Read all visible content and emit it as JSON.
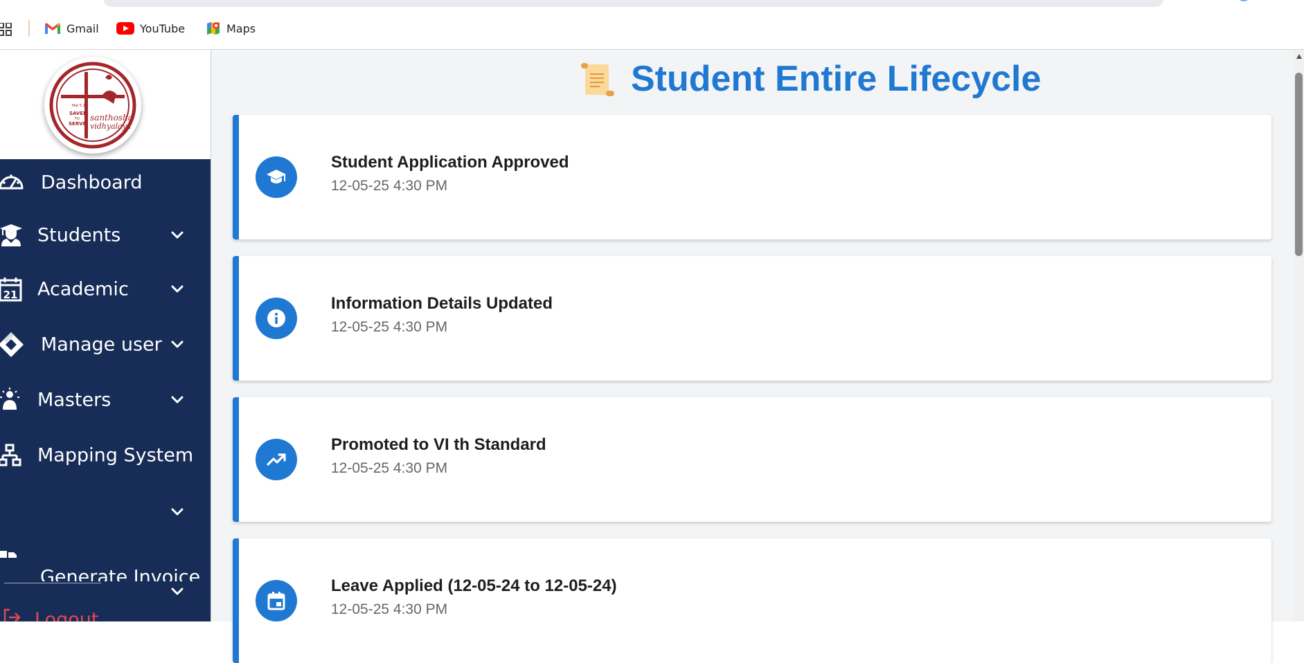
{
  "bookmarks": [
    {
      "label": "Gmail",
      "icon": "gmail-icon"
    },
    {
      "label": "YouTube",
      "icon": "youtube-icon"
    },
    {
      "label": "Maps",
      "icon": "maps-icon"
    }
  ],
  "sidebar": {
    "logo": {
      "texts": [
        "Mat 5.16",
        "SAVED",
        "TO",
        "SERVE",
        "santhosha",
        "vidhyalaya"
      ]
    },
    "items": [
      {
        "label": "Dashboard",
        "icon": "speedometer-icon",
        "has_dropdown": false
      },
      {
        "label": "Students",
        "icon": "graduate-icon",
        "has_dropdown": true
      },
      {
        "label": "Academic",
        "icon": "calendar-icon",
        "has_dropdown": true
      },
      {
        "label": "Manage user",
        "icon": "diamond-icon",
        "has_dropdown": true
      },
      {
        "label": "Masters",
        "icon": "settings-person-icon",
        "has_dropdown": true
      },
      {
        "label": "Mapping System",
        "icon": "sitemap-icon",
        "has_dropdown": true
      },
      {
        "label": "Generate Invoice",
        "icon": "invoice-icon",
        "has_dropdown": true
      }
    ],
    "calendar_day": "21",
    "logout_label": "Logout"
  },
  "main": {
    "title": "Student Entire Lifecycle",
    "title_icon": "scroll-icon",
    "events": [
      {
        "title": "Student Application Approved",
        "time": "12-05-25 4:30 PM",
        "icon": "graduation-cap-icon"
      },
      {
        "title": "Information Details Updated",
        "time": "12-05-25 4:30 PM",
        "icon": "info-icon"
      },
      {
        "title": "Promoted to VI th Standard",
        "time": "12-05-25 4:30 PM",
        "icon": "trending-up-icon"
      },
      {
        "title": "Leave Applied (12-05-24 to 12-05-24)",
        "time": "12-05-25 4:30 PM",
        "icon": "event-icon"
      }
    ]
  },
  "colors": {
    "sidebar_bg": "#172d57",
    "accent": "#1f78d1",
    "logout": "#e5484d",
    "main_bg": "#f3f4f6",
    "logo_red": "#a3262a"
  }
}
